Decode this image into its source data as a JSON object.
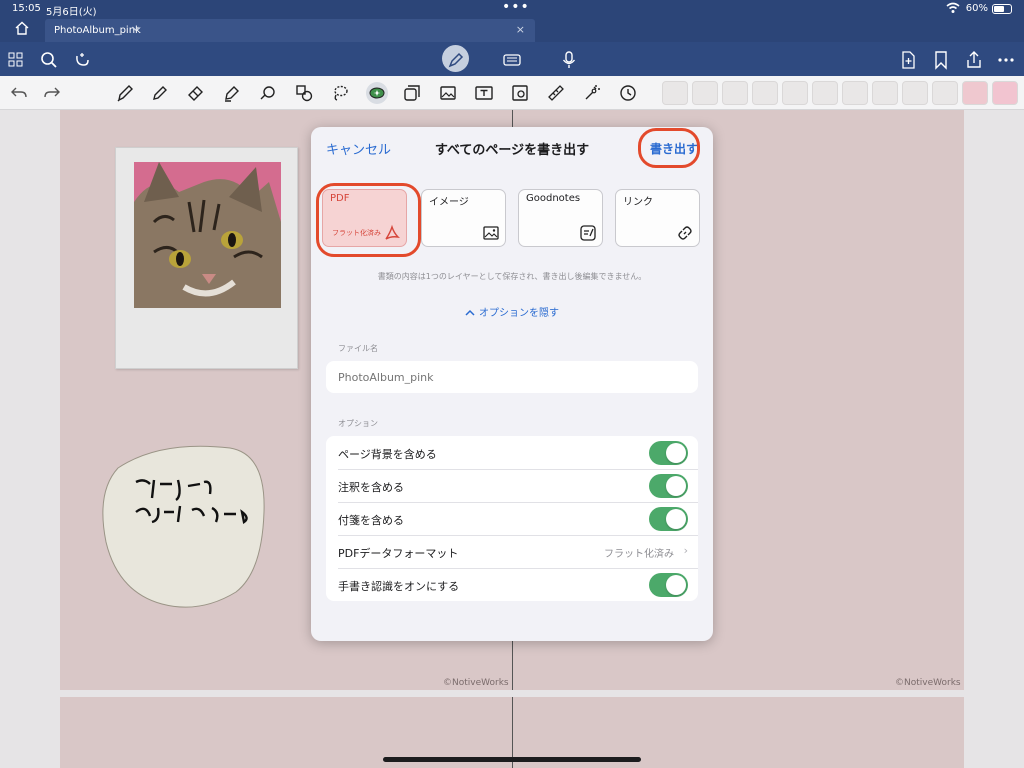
{
  "status": {
    "time": "15:05",
    "date": "5月6日(火)",
    "battery": "60%"
  },
  "tab": {
    "title": "PhotoAlbum_pink"
  },
  "canvas": {
    "credit_left": "©NotiveWorks",
    "credit_right": "©NotiveWorks"
  },
  "modal": {
    "cancel": "キャンセル",
    "title": "すべてのページを書き出す",
    "export": "書き出す",
    "formats": [
      {
        "name": "PDF",
        "sub": "フラット化済み",
        "icon": "pdf-icon",
        "selected": true
      },
      {
        "name": "イメージ",
        "icon": "image-icon"
      },
      {
        "name": "Goodnotes",
        "icon": "goodnotes-icon"
      },
      {
        "name": "リンク",
        "icon": "link-icon"
      }
    ],
    "hint": "書類の内容は1つのレイヤーとして保存され、書き出し後編集できません。",
    "hide_options": "オプションを隠す",
    "filename_label": "ファイル名",
    "filename_placeholder": "PhotoAlbum_pink",
    "options_label": "オプション",
    "options": [
      {
        "label": "ページ背景を含める",
        "type": "toggle",
        "on": true
      },
      {
        "label": "注釈を含める",
        "type": "toggle",
        "on": true
      },
      {
        "label": "付箋を含める",
        "type": "toggle",
        "on": true
      },
      {
        "label": "PDFデータフォーマット",
        "type": "value",
        "value": "フラット化済み"
      },
      {
        "label": "手書き認識をオンにする",
        "type": "toggle",
        "on": true
      }
    ]
  },
  "colors": {
    "accent": "#2a6bd1",
    "toggle_on": "#4ca96a",
    "highlight": "#e34a2c",
    "nav": "#2f4a80"
  }
}
